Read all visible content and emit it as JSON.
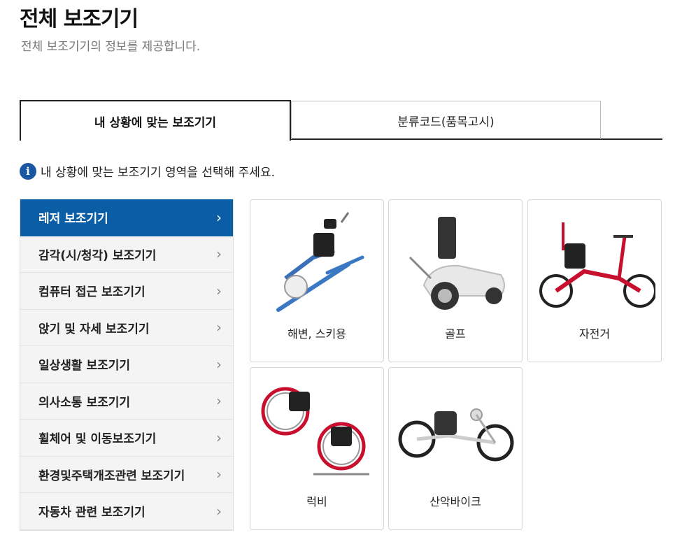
{
  "header": {
    "title": "전체 보조기기",
    "subtitle": "전체 보조기기의 정보를 제공합니다."
  },
  "tabs": [
    {
      "label": "내 상황에 맞는 보조기기"
    },
    {
      "label": "분류코드(품목고시)"
    }
  ],
  "notice": {
    "icon": "info-icon",
    "text": "내 상황에 맞는 보조기기 영역을 선택해 주세요."
  },
  "sidebar": {
    "items": [
      {
        "label": "레저 보조기기"
      },
      {
        "label": "감각(시/청각) 보조기기"
      },
      {
        "label": "컴퓨터 접근 보조기기"
      },
      {
        "label": "앉기 및 자세 보조기기"
      },
      {
        "label": "일상생활 보조기기"
      },
      {
        "label": "의사소통 보조기기"
      },
      {
        "label": "휠체어 및 이동보조기기"
      },
      {
        "label": "환경및주택개조관련 보조기기"
      },
      {
        "label": "자동차 관련 보조기기"
      }
    ],
    "chevron": "›"
  },
  "cards": [
    {
      "label": "해변, 스키용"
    },
    {
      "label": "골프"
    },
    {
      "label": "자전거"
    },
    {
      "label": "럭비"
    },
    {
      "label": "산악바이크"
    }
  ],
  "colors": {
    "accent": "#0b5da6",
    "info_icon": "#1b56a3"
  }
}
